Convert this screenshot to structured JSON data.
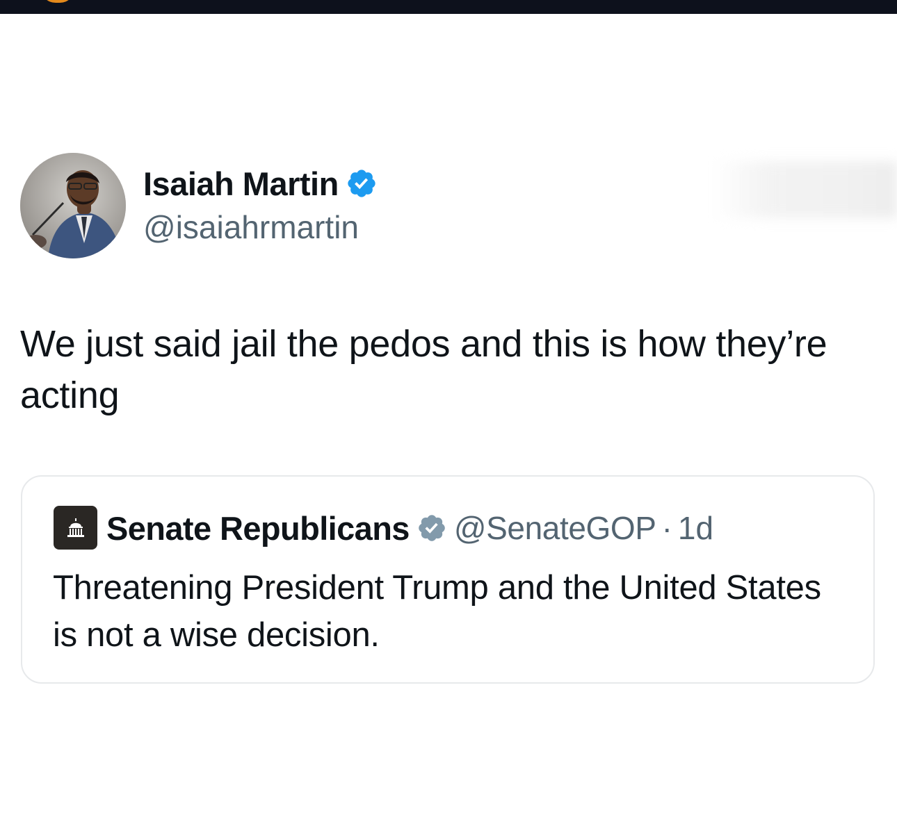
{
  "tweet": {
    "author": {
      "name": "Isaiah Martin",
      "handle": "@isaiahrmartin",
      "verified": true,
      "verified_color": "#1d9bf0"
    },
    "text": "We just said jail the pedos and this is how they’re acting",
    "quoted": {
      "author": {
        "name": "Senate Republicans",
        "handle": "@SenateGOP",
        "verified": true,
        "verified_color": "#829aab",
        "avatar_icon": "capitol-building-icon"
      },
      "separator": "·",
      "time": "1d",
      "text": "Threatening President Trump and the United States is not a wise decision."
    }
  }
}
